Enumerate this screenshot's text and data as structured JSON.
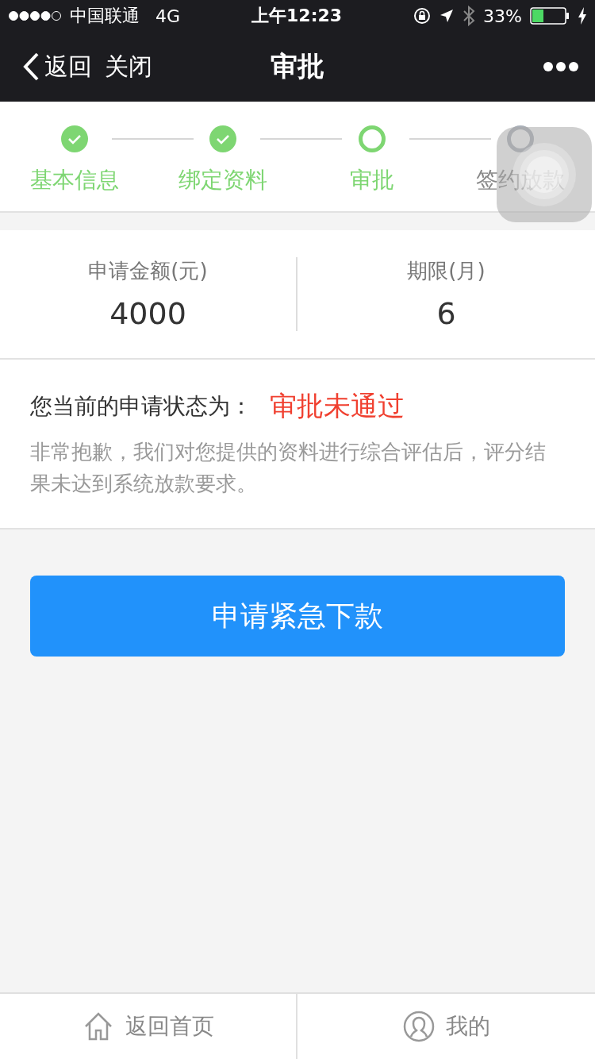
{
  "status_bar": {
    "carrier": "中国联通",
    "network": "4G",
    "time": "上午12:23",
    "battery": "33%"
  },
  "nav": {
    "back": "返回",
    "close": "关闭",
    "title": "审批"
  },
  "steps": [
    {
      "label": "基本信息",
      "done": true,
      "selected": false
    },
    {
      "label": "绑定资料",
      "done": true,
      "selected": false
    },
    {
      "label": "审批",
      "done": false,
      "selected": true
    },
    {
      "label": "签约放款",
      "done": false,
      "selected": false
    }
  ],
  "summary": [
    {
      "label": "申请金额(元)",
      "value": "4000"
    },
    {
      "label": "期限(月)",
      "value": "6"
    }
  ],
  "status": {
    "label": "您当前的申请状态为：",
    "value": "审批未通过",
    "message": "非常抱歉，我们对您提供的资料进行综合评估后，评分结果未达到系统放款要求。"
  },
  "action": "申请紧急下款",
  "tab_bar": [
    {
      "label": "返回首页",
      "kind": "home"
    },
    {
      "label": "我的",
      "kind": "profile"
    }
  ]
}
